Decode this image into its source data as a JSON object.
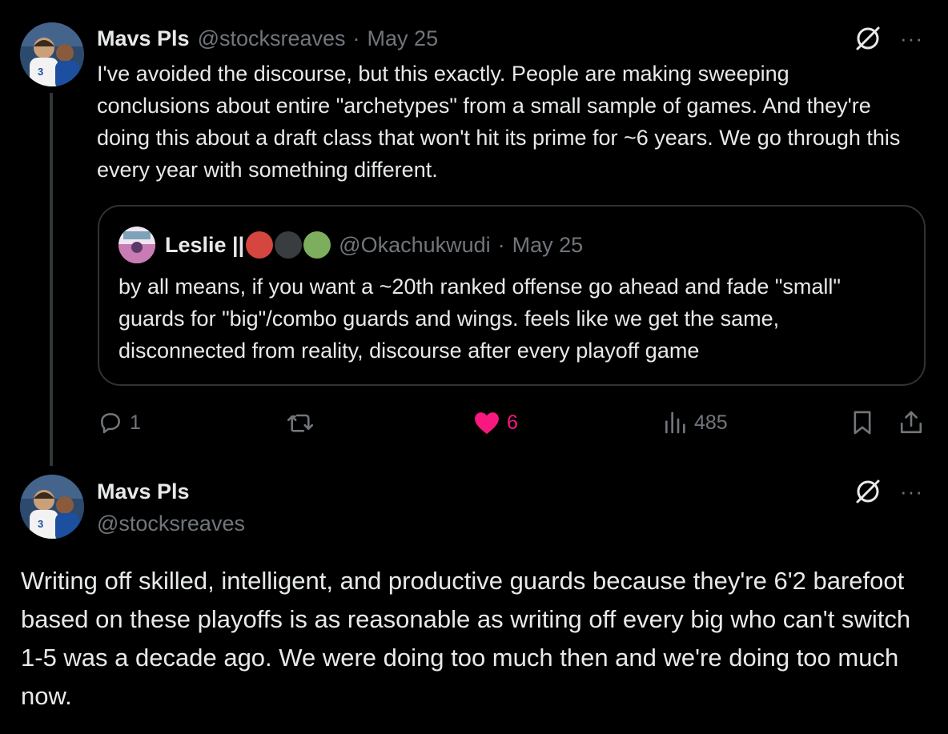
{
  "colors": {
    "background": "#000000",
    "text": "#e7e9ea",
    "muted": "#71767b",
    "border": "#2f3336",
    "like_pink": "#f91880",
    "dot_red": "#d4463f",
    "dot_gray": "#3a3d40",
    "dot_green": "#7dae5e"
  },
  "tweet1": {
    "author_name": "Mavs Pls",
    "handle": "@stocksreaves",
    "separator": "·",
    "date": "May 25",
    "text": "I've avoided the discourse, but this exactly. People are making sweeping conclusions about entire \"archetypes\" from a small sample of games. And they're doing this about a draft class that won't hit its prime for ~6 years. We go through this every year with something different.",
    "grok_icon": "grok-icon",
    "more_icon": "more-icon",
    "more_glyph": "···",
    "quoted": {
      "author_name": "Leslie ||",
      "emoji_dots": [
        "red",
        "gray",
        "green"
      ],
      "handle": "@Okachukwudi",
      "separator": "·",
      "date": "May 25",
      "text": "by all means, if you want a ~20th ranked offense go ahead and fade \"small\" guards for \"big\"/combo guards and wings. feels like we get the same, disconnected from reality, discourse after every playoff game"
    },
    "actions": {
      "reply_count": "1",
      "retweet_count": "",
      "like_count": "6",
      "like_state": "liked",
      "views_count": "485"
    }
  },
  "tweet2": {
    "author_name": "Mavs Pls",
    "handle": "@stocksreaves",
    "text": "Writing off skilled, intelligent, and productive guards because they're 6'2 barefoot based on these playoffs is as reasonable as writing off every big who can't switch 1-5 was a decade ago. We were doing too much then and we're doing too much now.",
    "grok_icon": "grok-icon",
    "more_icon": "more-icon",
    "more_glyph": "···"
  }
}
